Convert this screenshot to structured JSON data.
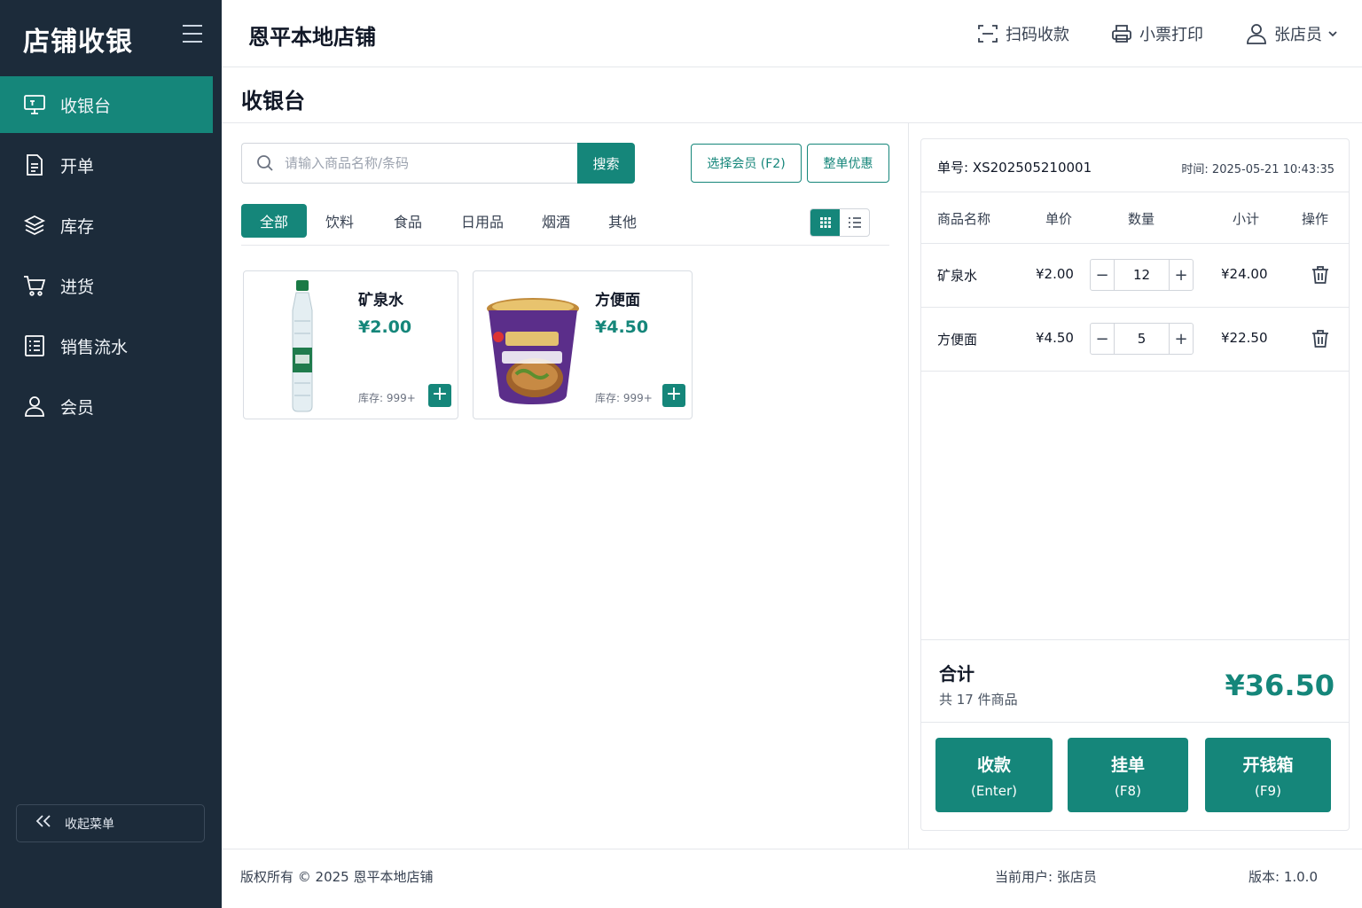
{
  "sidebar": {
    "brand": "店铺收银",
    "items": [
      {
        "label": "收银台",
        "icon": "monitor-icon",
        "active": true
      },
      {
        "label": "开单",
        "icon": "document-icon"
      },
      {
        "label": "库存",
        "icon": "layers-icon"
      },
      {
        "label": "进货",
        "icon": "cart-icon"
      },
      {
        "label": "销售流水",
        "icon": "list-icon"
      },
      {
        "label": "会员",
        "icon": "user-icon"
      }
    ],
    "collapse_label": "收起菜单"
  },
  "header": {
    "store_name": "恩平本地店铺",
    "scan_label": "扫码收款",
    "print_label": "小票打印",
    "user_label": "张店员"
  },
  "page_title": "收银台",
  "search": {
    "placeholder": "请输入商品名称/条码",
    "button": "搜索"
  },
  "actions": {
    "member": "选择会员 (F2)",
    "discount": "整单优惠"
  },
  "categories": [
    "全部",
    "饮料",
    "食品",
    "日用品",
    "烟酒",
    "其他"
  ],
  "products": [
    {
      "name": "矿泉水",
      "price": "¥2.00",
      "stock": "库存: 999+"
    },
    {
      "name": "方便面",
      "price": "¥4.50",
      "stock": "库存: 999+"
    }
  ],
  "order": {
    "number": "单号: XS202505210001",
    "time": "时间: 2025-05-21 10:43:35",
    "columns": [
      "商品名称",
      "单价",
      "数量",
      "小计",
      "操作"
    ],
    "items": [
      {
        "name": "矿泉水",
        "price": "¥2.00",
        "qty": "12",
        "subtotal": "¥24.00"
      },
      {
        "name": "方便面",
        "price": "¥4.50",
        "qty": "5",
        "subtotal": "¥22.50"
      }
    ],
    "total_label": "合计",
    "total_count": "共 17 件商品",
    "total_amount": "¥36.50",
    "buttons": [
      {
        "label": "收款",
        "key": "(Enter)"
      },
      {
        "label": "挂单",
        "key": "(F8)"
      },
      {
        "label": "开钱箱",
        "key": "(F9)"
      }
    ]
  },
  "footer": {
    "copyright": "版权所有 © 2025 恩平本地店铺",
    "current_user": "当前用户: 张店员",
    "version": "版本: 1.0.0"
  },
  "colors": {
    "sidebar_bg": "#1c2b3a",
    "accent": "#15867a"
  }
}
